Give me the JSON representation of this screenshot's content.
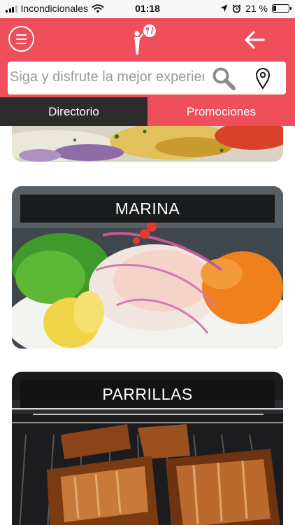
{
  "status_bar": {
    "carrier": "Incondicionales",
    "time": "01:18",
    "battery_text": "21 %",
    "battery_level": 0.21
  },
  "header": {
    "background_color": "#ef4f5b",
    "menu_icon": "hamburger-menu-icon",
    "logo_icon": "waiter-logo-icon",
    "back_icon": "arrow-left-icon"
  },
  "search": {
    "placeholder": "Siga y disfrute la mejor experiencia",
    "search_icon": "search-icon",
    "location_icon": "location-pin-icon"
  },
  "tabs": [
    {
      "label": "Directorio",
      "active": true,
      "color": "#2c2c2c"
    },
    {
      "label": "Promociones",
      "active": false,
      "color": "#ef4f5b"
    }
  ],
  "categories": [
    {
      "title": ""
    },
    {
      "title": "MARINA"
    },
    {
      "title": "PARRILLAS"
    }
  ]
}
